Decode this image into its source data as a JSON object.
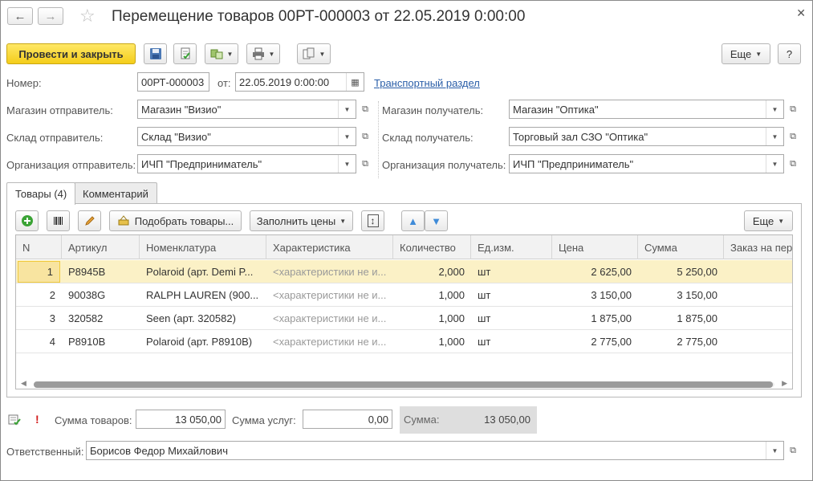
{
  "window": {
    "title": "Перемещение товаров 00РТ-000003 от 22.05.2019 0:00:00",
    "back_icon": "arrow-left",
    "forward_icon": "arrow-right",
    "favorite_icon": "star",
    "close_icon": "close"
  },
  "toolbar": {
    "post_and_close": "Провести и закрыть",
    "more": "Еще",
    "help": "?"
  },
  "form": {
    "number_label": "Номер:",
    "number_value": "00РТ-000003",
    "date_label": "от:",
    "date_value": "22.05.2019  0:00:00",
    "transport_link": "Транспортный раздел",
    "store_from_label": "Магазин отправитель:",
    "store_from_value": "Магазин \"Визио\"",
    "store_to_label": "Магазин получатель:",
    "store_to_value": "Магазин \"Оптика\"",
    "warehouse_from_label": "Склад отправитель:",
    "warehouse_from_value": "Склад \"Визио\"",
    "warehouse_to_label": "Склад получатель:",
    "warehouse_to_value": "Торговый зал СЗО \"Оптика\"",
    "org_from_label": "Организация отправитель:",
    "org_from_value": "ИЧП \"Предприниматель\"",
    "org_to_label": "Организация получатель:",
    "org_to_value": "ИЧП \"Предприниматель\""
  },
  "tabs": [
    {
      "label": "Товары (4)",
      "active": true
    },
    {
      "label": "Комментарий",
      "active": false
    }
  ],
  "goods_toolbar": {
    "pick_goods": "Подобрать товары...",
    "fill_prices": "Заполнить цены",
    "more": "Еще"
  },
  "table": {
    "columns": [
      "N",
      "Артикул",
      "Номенклатура",
      "Характеристика",
      "Количество",
      "Ед.изм.",
      "Цена",
      "Сумма",
      "Заказ на пер"
    ],
    "rows": [
      {
        "n": "1",
        "article": "P8945B",
        "item": "Polaroid (арт. Demi P...",
        "characteristic": "<характеристики не и...",
        "qty": "2,000",
        "unit": "шт",
        "price": "2 625,00",
        "sum": "5 250,00",
        "order": "",
        "selected": true
      },
      {
        "n": "2",
        "article": "90038G",
        "item": "RALPH LAUREN (900...",
        "characteristic": "<характеристики не и...",
        "qty": "1,000",
        "unit": "шт",
        "price": "3 150,00",
        "sum": "3 150,00",
        "order": "",
        "selected": false
      },
      {
        "n": "3",
        "article": "320582",
        "item": "Seen (арт. 320582)",
        "characteristic": "<характеристики не и...",
        "qty": "1,000",
        "unit": "шт",
        "price": "1 875,00",
        "sum": "1 875,00",
        "order": "",
        "selected": false
      },
      {
        "n": "4",
        "article": "P8910B",
        "item": "Polaroid (арт. P8910B)",
        "characteristic": "<характеристики не и...",
        "qty": "1,000",
        "unit": "шт",
        "price": "2 775,00",
        "sum": "2 775,00",
        "order": "",
        "selected": false
      }
    ]
  },
  "totals": {
    "goods_sum_label": "Сумма товаров:",
    "goods_sum_value": "13 050,00",
    "services_sum_label": "Сумма услуг:",
    "services_sum_value": "0,00",
    "total_label": "Сумма:",
    "total_value": "13 050,00",
    "warning_mark": "!"
  },
  "responsible": {
    "label": "Ответственный:",
    "value": "Борисов Федор Михайлович"
  },
  "colors": {
    "primary_button": "#f4cd1a",
    "selected_row": "#fbf1c6",
    "link": "#2a5ea8",
    "add_icon": "#3aa335",
    "arrow_icon": "#3f8bd8"
  }
}
